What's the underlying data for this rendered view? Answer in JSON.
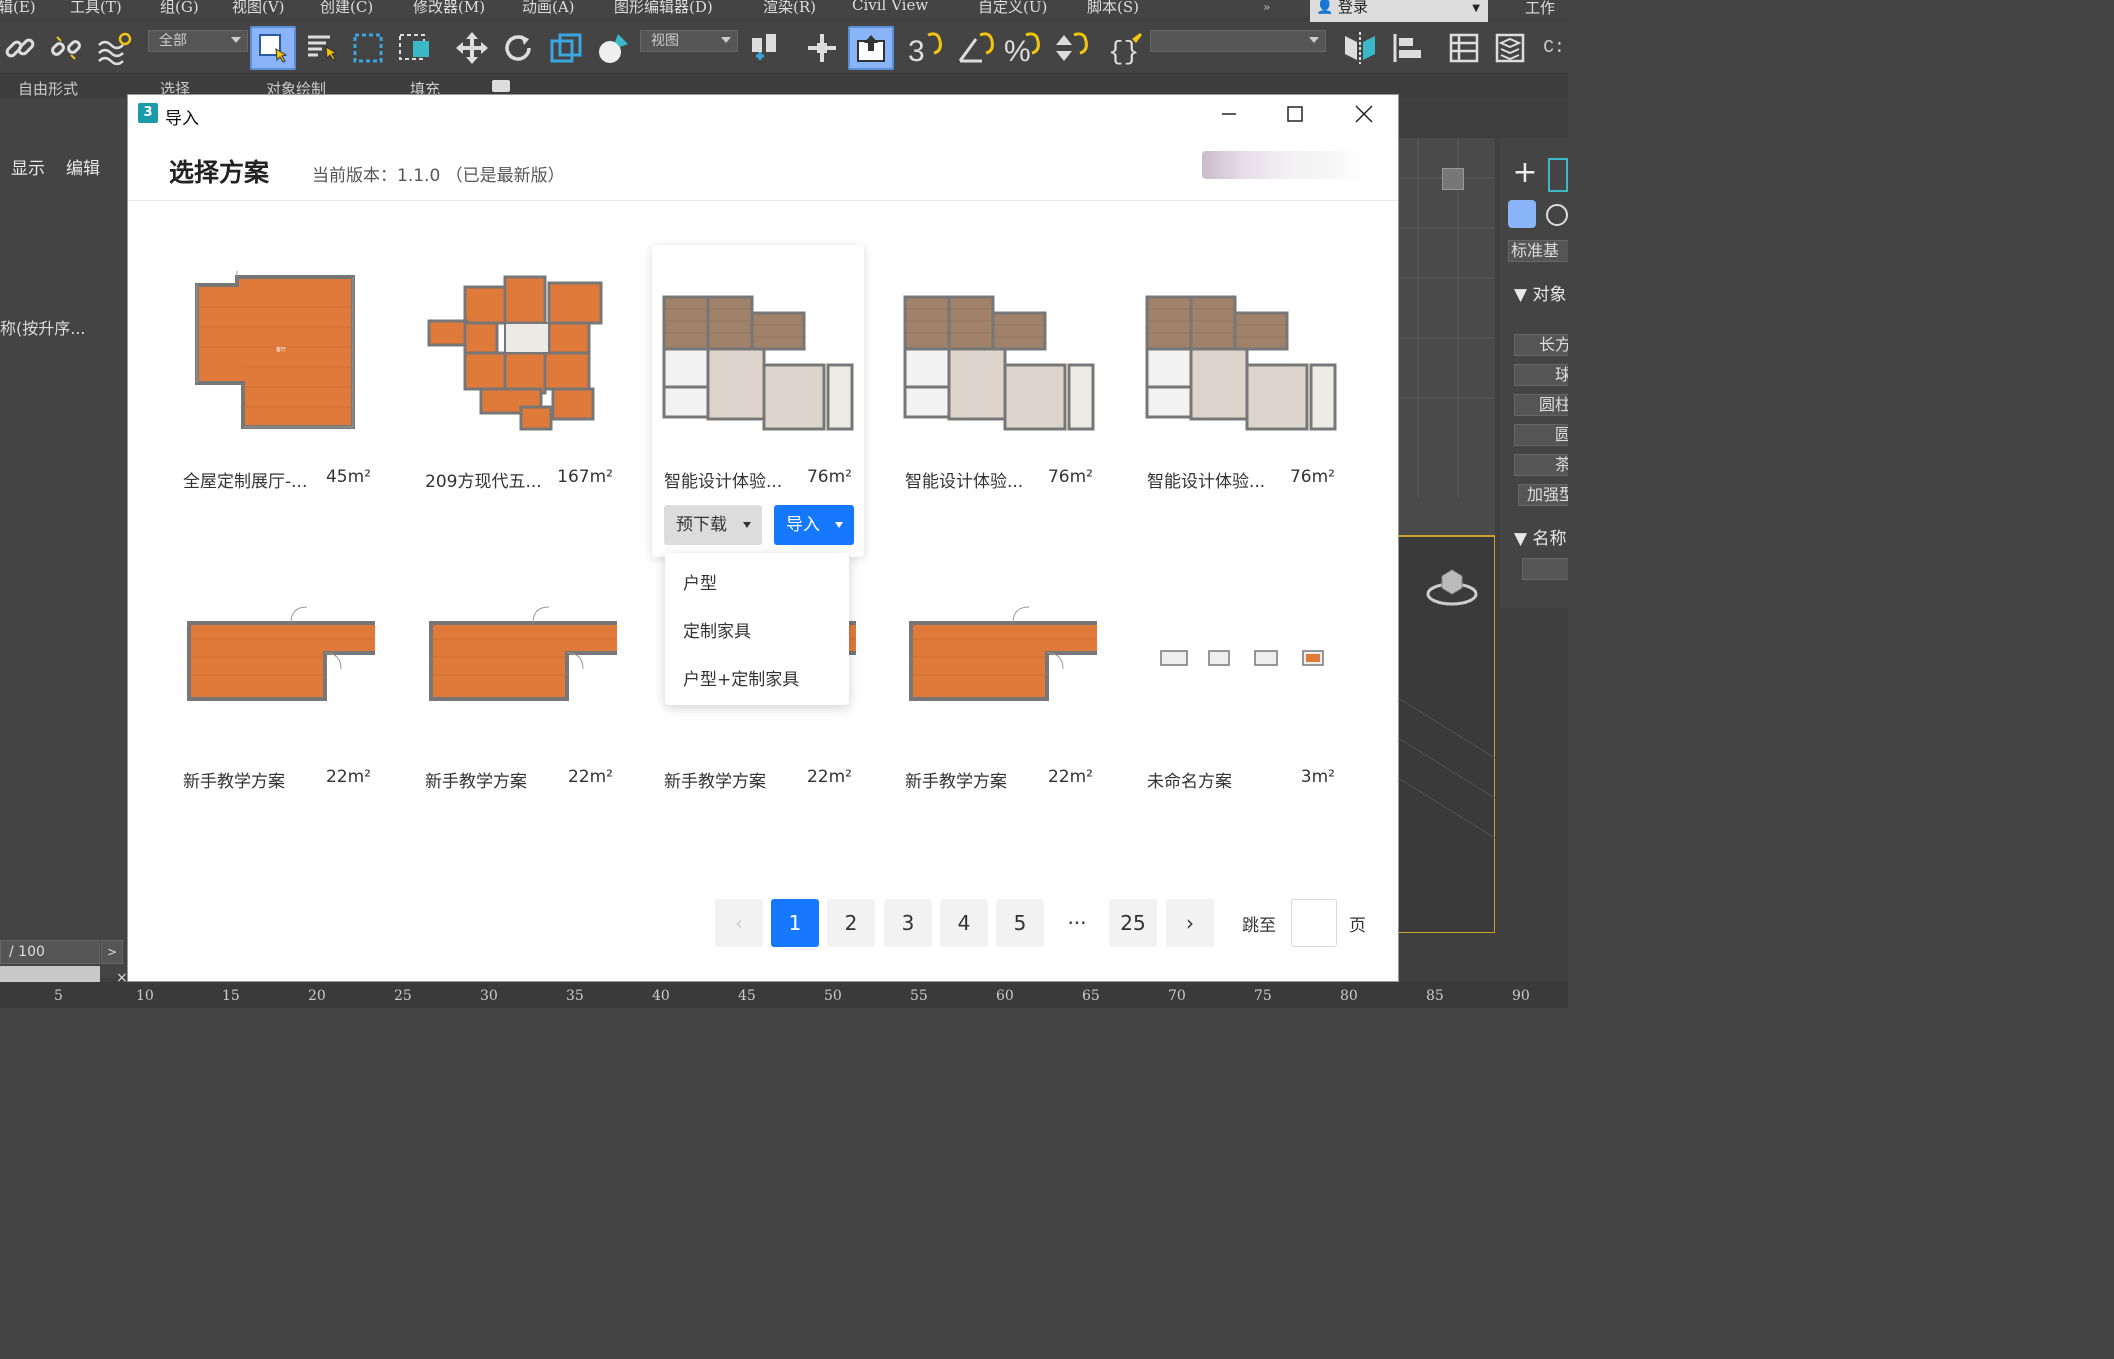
{
  "max": {
    "menus": [
      "辑(E)",
      "工具(T)",
      "组(G)",
      "视图(V)",
      "创建(C)",
      "修改器(M)",
      "动画(A)",
      "图形编辑器(D)",
      "渲染(R)",
      "Civil View",
      "自定义(U)",
      "脚本(S)"
    ],
    "login_label": "登录",
    "workspace_label": "工作区",
    "selection_filter": "全部",
    "view_dropdown": "视图",
    "ribbon_tabs": [
      "自由形式",
      "选择",
      "对象绘制",
      "填充"
    ],
    "left_headers": [
      "显示",
      "编辑"
    ],
    "name_column": "称(按升序...",
    "frame_field": "/ 100",
    "frame_btn": ">",
    "right_panel": {
      "std": "标准基",
      "sec_objtype": "对象",
      "items": [
        "长方",
        "球",
        "圆柱",
        "圆",
        "茶",
        "加强型"
      ],
      "sec_name": "名称"
    },
    "ruler": [
      "5",
      "10",
      "15",
      "20",
      "25",
      "30",
      "35",
      "40",
      "45",
      "50",
      "55",
      "60",
      "65",
      "70",
      "75",
      "80",
      "85",
      "90"
    ]
  },
  "dialog": {
    "title": "导入",
    "heading": "选择方案",
    "version": "当前版本：1.1.0 （已是最新版）",
    "cards": [
      {
        "name": "全屋定制展厅-...",
        "area": "45m²"
      },
      {
        "name": "209方现代五...",
        "area": "167m²"
      },
      {
        "name": "智能设计体验...",
        "area": "76m²"
      },
      {
        "name": "智能设计体验...",
        "area": "76m²"
      },
      {
        "name": "智能设计体验...",
        "area": "76m²"
      },
      {
        "name": "新手教学方案",
        "area": "22m²"
      },
      {
        "name": "新手教学方案",
        "area": "22m²"
      },
      {
        "name": "新手教学方案",
        "area": "22m²"
      },
      {
        "name": "新手教学方案",
        "area": "22m²"
      },
      {
        "name": "未命名方案",
        "area": "3m²"
      }
    ],
    "predownload_label": "预下载",
    "import_label": "导入",
    "dropdown_items": [
      "户型",
      "定制家具",
      "户型+定制家具"
    ],
    "pagination": {
      "prev": "‹",
      "pages": [
        "1",
        "2",
        "3",
        "4",
        "5"
      ],
      "ellipsis": "···",
      "last": "25",
      "next": "›",
      "current": "1"
    },
    "jump_label": "跳至",
    "jump_suffix": "页",
    "colors": {
      "primary": "#1677ff",
      "floor": "#e07a3a",
      "wall": "#777777"
    }
  }
}
